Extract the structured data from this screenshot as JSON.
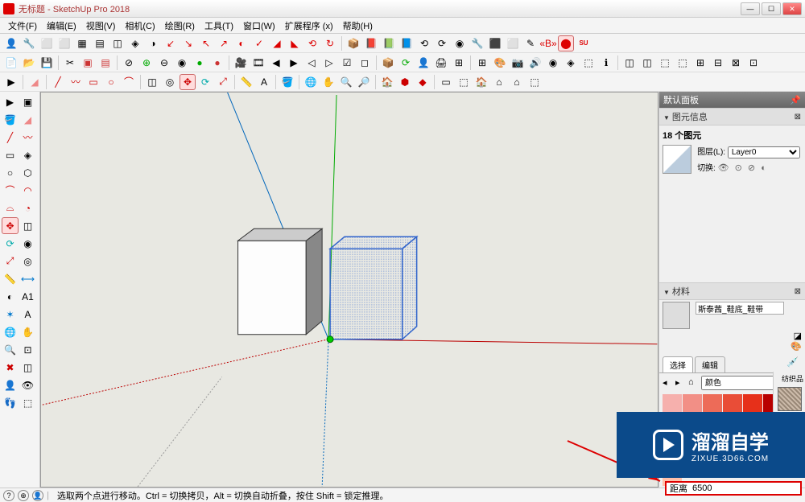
{
  "window": {
    "title": "无标题 - SketchUp Pro 2018"
  },
  "menu": {
    "items": [
      "文件(F)",
      "编辑(E)",
      "视图(V)",
      "相机(C)",
      "绘图(R)",
      "工具(T)",
      "窗口(W)",
      "扩展程序 (x)",
      "帮助(H)"
    ]
  },
  "panels": {
    "default": "默认面板",
    "entity": {
      "title": "图元信息",
      "count": "18 个图元",
      "layer_label": "图层(L):",
      "layer_value": "Layer0",
      "toggle_label": "切换:"
    },
    "material": {
      "title": "材料",
      "name": "斯泰茜_鞋底_鞋带",
      "tab_select": "选择",
      "tab_edit": "编辑",
      "dropdown": "颜色"
    },
    "org": "纺织品"
  },
  "swatches": {
    "colors": [
      "#f6b0ad",
      "#f28f86",
      "#ed6b58",
      "#e94d37",
      "#e6301a",
      "#b80000",
      "#960000",
      "#7a0000",
      "#5c0c0c",
      "#3d0808",
      "#f6cdb0",
      "#f2b98f",
      "#eda46b",
      "#e98f4d",
      "#e67a30",
      "#f29d62",
      "#ed8640",
      "#d66d1e",
      "#b85510",
      "#8a3a06",
      "#fff3aa",
      "#fffaaa",
      "#ffe0aa",
      "#ffd0aa",
      "#ffc0aa"
    ]
  },
  "status": {
    "hint": "选取两个点进行移动。Ctrl = 切换拷贝，Alt = 切换自动折叠，按住 Shift = 锁定推理。",
    "measure_label": "距离",
    "measure_value": "6500"
  },
  "watermark": {
    "brand": "溜溜自学",
    "url": "ZIXUE.3D66.COM"
  }
}
